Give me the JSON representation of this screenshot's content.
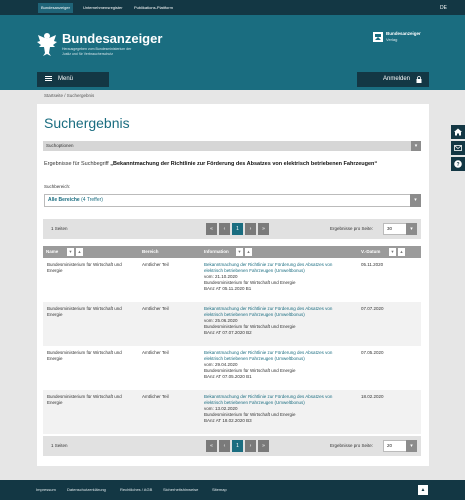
{
  "topbar": {
    "tabs": [
      "Bundesanzeiger",
      "Unternehmensregister",
      "Publikations-Plattform"
    ],
    "language": "DE"
  },
  "header": {
    "title": "Bundesanzeiger",
    "subtitle": "Herausgegeben vom Bundesministerium der Justiz und für Verbraucherschutz",
    "publisher_title": "Bundesanzeiger",
    "publisher_sub": "Verlag"
  },
  "nav": {
    "menu_label": "Menü",
    "login_label": "Anmelden"
  },
  "breadcrumb": "Startseite / Suchergebnis",
  "main": {
    "title": "Suchergebnis",
    "options_label": "Suchoptionen",
    "result_prefix": "Ergebnisse für Suchbegriff ",
    "result_term": "„Bekanntmachung der Richtlinie zur Förderung des Absatzes von elektrisch betriebenen Fahrzeugen“",
    "area_label": "Suchbereich:",
    "area_value": "Alle Bereiche",
    "area_count": "(4 Treffer)"
  },
  "pager": {
    "pages_text": "1 Seiten",
    "pages_text_bottom": "1 Seiten",
    "current_page": "1",
    "per_page_label": "Ergebnisse pro Seite:",
    "per_page_value": "30",
    "per_page_value_bottom": "20"
  },
  "table": {
    "headers": {
      "name": "Name",
      "area": "Bereich",
      "info": "Information",
      "date": "V.-Datum"
    },
    "rows": [
      {
        "name": "Bundesministerium für Wirtschaft und Energie",
        "area": "Amtlicher Teil",
        "link": "Bekanntmachung der Richtlinie zur Förderung des Absatzes von elektrisch betriebenen Fahrzeugen (Umweltbonus)",
        "from": "vom: 21.10.2020",
        "ministry": "Bundesministerium für Wirtschaft und Energie",
        "banz": "BAnz AT 05.11.2020 B1",
        "date": "05.11.2020"
      },
      {
        "name": "Bundesministerium für Wirtschaft und Energie",
        "area": "Amtlicher Teil",
        "link": "Bekanntmachung der Richtlinie zur Förderung des Absatzes von elektrisch betriebenen Fahrzeugen (Umweltbonus)",
        "from": "vom: 25.06.2020",
        "ministry": "Bundesministerium für Wirtschaft und Energie",
        "banz": "BAnz AT 07.07.2020 B2",
        "date": "07.07.2020"
      },
      {
        "name": "Bundesministerium für Wirtschaft und Energie",
        "area": "Amtlicher Teil",
        "link": "Bekanntmachung der Richtlinie zur Förderung des Absatzes von elektrisch betriebenen Fahrzeugen (Umweltbonus)",
        "from": "vom: 29.04.2020",
        "ministry": "Bundesministerium für Wirtschaft und Energie",
        "banz": "BAnz AT 07.05.2020 B1",
        "date": "07.05.2020"
      },
      {
        "name": "Bundesministerium für Wirtschaft und Energie",
        "area": "Amtlicher Teil",
        "link": "Bekanntmachung der Richtlinie zur Förderung des Absatzes von elektrisch betriebenen Fahrzeugen (Umweltbonus)",
        "from": "vom: 13.02.2020",
        "ministry": "Bundesministerium für Wirtschaft und Energie",
        "banz": "BAnz AT 18.02.2020 B3",
        "date": "18.02.2020"
      }
    ]
  },
  "side_buttons": [
    "home-icon",
    "mail-icon",
    "help-icon"
  ],
  "footer": {
    "links": [
      "Impressum",
      "Datenschutzerklärung",
      "Rechtliches / AGB",
      "Sicherheitshinweise",
      "Sitemap"
    ]
  },
  "colors": {
    "brand": "#1a6d80",
    "dark": "#133744"
  }
}
